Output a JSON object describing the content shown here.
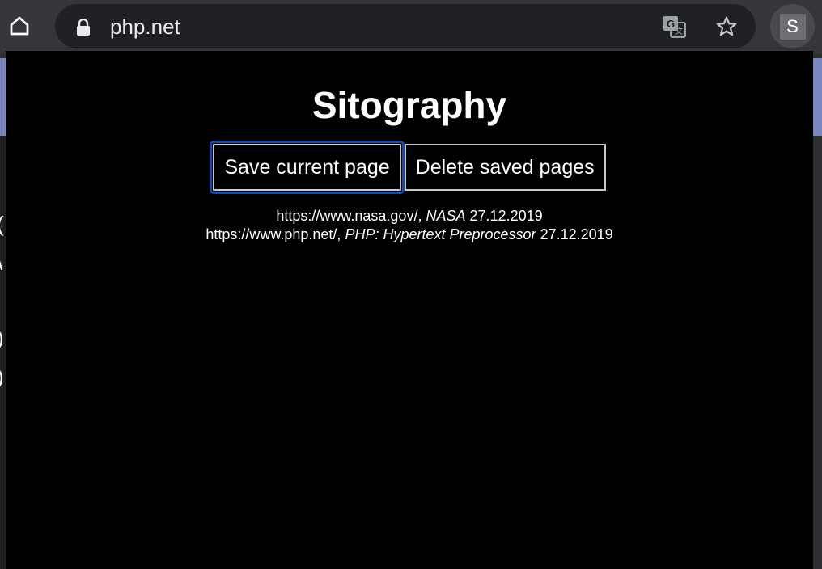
{
  "browser": {
    "url": "php.net",
    "profile_initial": "S"
  },
  "popup": {
    "title": "Sitography",
    "buttons": {
      "save": "Save current page",
      "delete": "Delete saved pages"
    },
    "entries": [
      {
        "url": "https://www.nasa.gov/",
        "sep": ",",
        "title": "NASA",
        "date": "27.12.2019"
      },
      {
        "url": "https://www.php.net/",
        "sep": ",",
        "title": "PHP: Hypertext Preprocessor",
        "date": "27.12.2019"
      }
    ]
  },
  "colors": {
    "toolbar": "#35363a",
    "omnibox": "#202124",
    "popup_bg": "#000000",
    "focus_ring": "#1a4aa8"
  }
}
